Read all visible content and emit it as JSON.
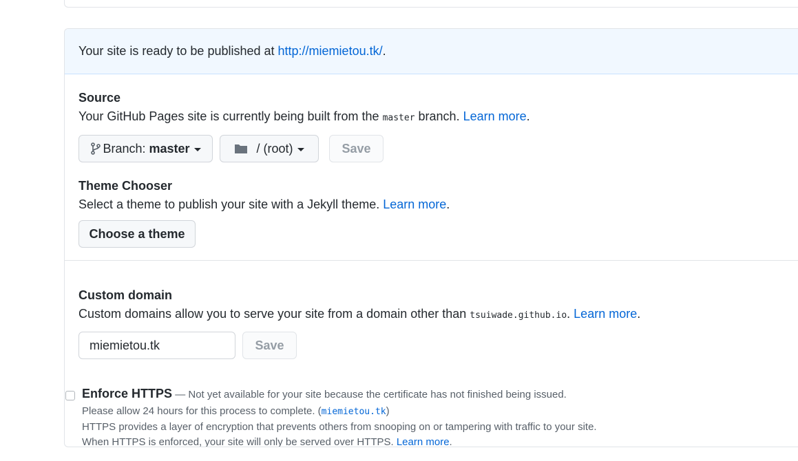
{
  "publish_notice": {
    "prefix": "Your site is ready to be published at ",
    "url": "http://miemietou.tk/",
    "suffix": "."
  },
  "source": {
    "title": "Source",
    "desc_prefix": "Your GitHub Pages site is currently being built from the ",
    "branch_code": "master",
    "desc_suffix": " branch. ",
    "learn_more": "Learn more",
    "period": ".",
    "branch_label": "Branch: ",
    "branch_value": "master",
    "folder_label": "/ (root)",
    "save_label": "Save"
  },
  "theme": {
    "title": "Theme Chooser",
    "desc": "Select a theme to publish your site with a Jekyll theme. ",
    "learn_more": "Learn more",
    "period": ".",
    "button": "Choose a theme"
  },
  "custom_domain": {
    "title": "Custom domain",
    "desc_prefix": "Custom domains allow you to serve your site from a domain other than ",
    "domain_code": "tsuiwade.github.io",
    "desc_suffix": ". ",
    "learn_more": "Learn more",
    "period": ".",
    "input_value": "miemietou.tk",
    "save_label": "Save"
  },
  "https": {
    "title": "Enforce HTTPS",
    "status": " — Not yet available for your site because the certificate has not finished being issued.",
    "note_prefix": "Please allow 24 hours for this process to complete. (",
    "note_code": "miemietou.tk",
    "note_suffix": ")",
    "line2": "HTTPS provides a layer of encryption that prevents others from snooping on or tampering with traffic to your site.",
    "line3": "When HTTPS is enforced, your site will only be served over HTTPS. ",
    "learn_more": "Learn more",
    "period": "."
  },
  "colors": {
    "link": "#0366d6",
    "flash_bg": "#f1f8ff",
    "border": "#e1e4e8"
  }
}
